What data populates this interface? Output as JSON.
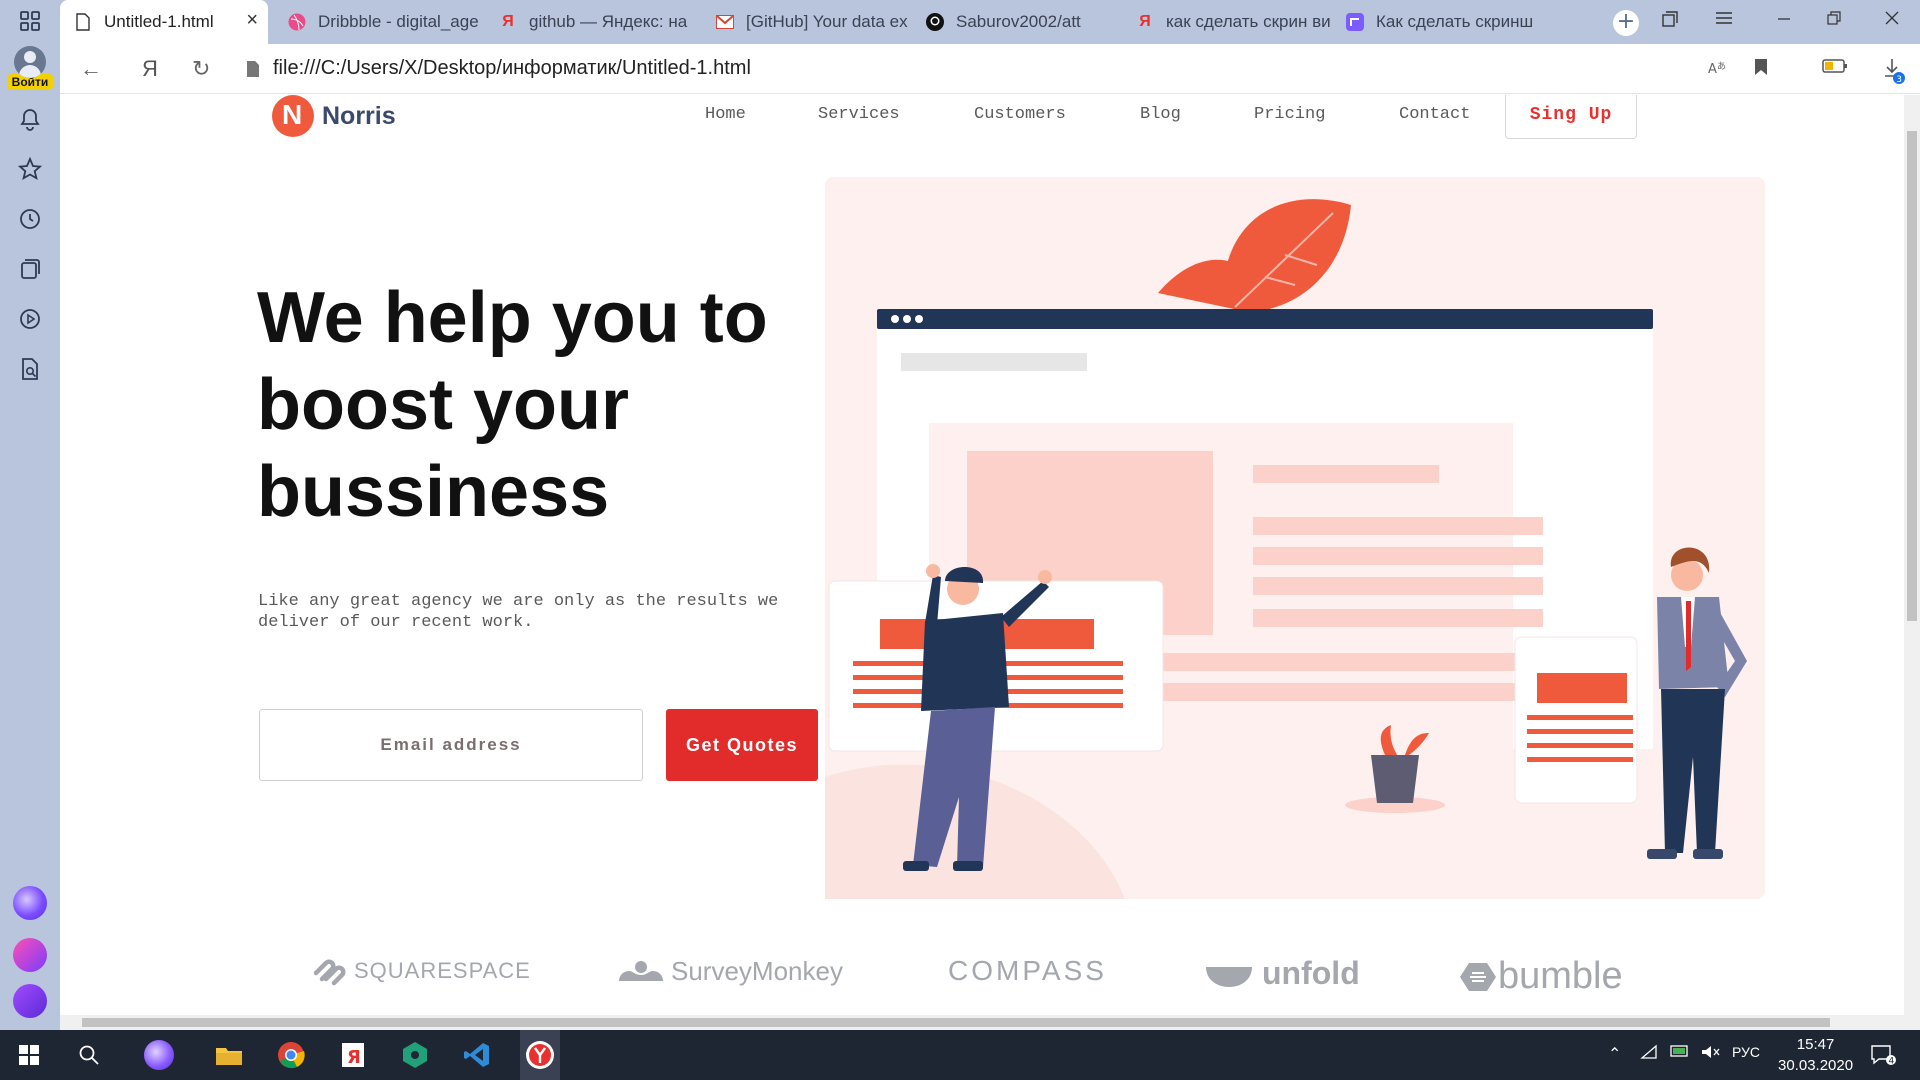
{
  "browser": {
    "sidebar": {
      "login_label": "Войти",
      "icons": [
        "apps-icon",
        "bell-icon",
        "star-icon",
        "history-icon",
        "collections-icon",
        "video-icon",
        "search-document-icon"
      ],
      "bottom_icons": [
        "alice-icon",
        "messenger-icon",
        "assistant-icon"
      ]
    },
    "tabs": [
      {
        "title": "Untitled-1.html",
        "icon": "document-icon",
        "active": true
      },
      {
        "title": "Dribbble - digital_age",
        "icon": "dribbble-icon"
      },
      {
        "title": "github — Яндекс: на",
        "icon": "yandex-icon"
      },
      {
        "title": "[GitHub] Your data ex",
        "icon": "gmail-icon"
      },
      {
        "title": "Saburov2002/att",
        "icon": "github-icon"
      },
      {
        "title": "как сделать скрин ви",
        "icon": "yandex-icon"
      },
      {
        "title": "Как сделать скринш",
        "icon": "zen-icon"
      }
    ],
    "tab_close": "×",
    "new_tab": "+",
    "url": "file:///C:/Users/X/Desktop/информатик/Untitled-1.html",
    "yandex_glyph": "Я",
    "download_count": "3"
  },
  "site": {
    "brand": "Norris",
    "nav": [
      "Home",
      "Services",
      "Customers",
      "Blog",
      "Pricing",
      "Contact"
    ],
    "signup": "Sing Up",
    "hero_title": "We help you to boost your bussiness",
    "hero_sub": "Like any great agency we are only as the results we deliver of our recent work.",
    "email_placeholder": "Email address",
    "cta": "Get Quotes",
    "logos": [
      "SQUARESPACE",
      "SurveyMonkey",
      "COMPASS",
      "unfold",
      "bumble"
    ],
    "colors": {
      "accent": "#e22b2b",
      "illustration_bg": "#fdf0ee",
      "illustration_red": "#f05a3c",
      "navy": "#213557"
    }
  },
  "taskbar": {
    "time": "15:47",
    "date": "30.03.2020",
    "lang": "РУС",
    "notifications": "4",
    "apps": [
      "windows-start-icon",
      "search-icon",
      "alice-icon",
      "file-explorer-icon",
      "chrome-icon",
      "yandex-icon",
      "app-icon",
      "vscode-icon",
      "yandex-browser-icon"
    ]
  }
}
